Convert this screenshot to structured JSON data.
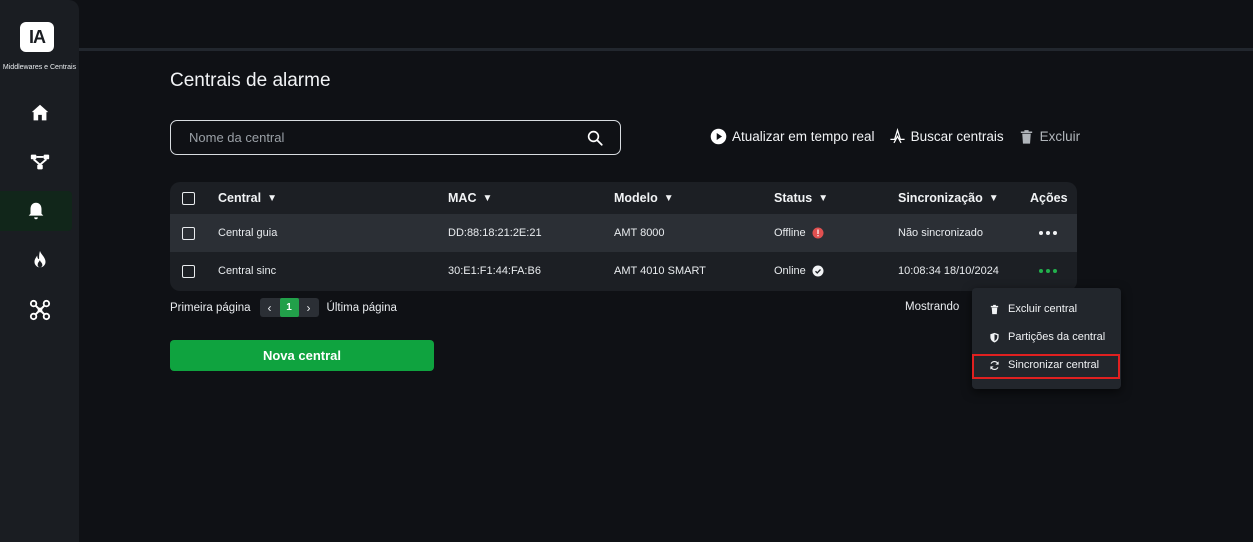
{
  "sidebar": {
    "logo_text": "IA",
    "brand_subtitle": "Middlewares e Centrais",
    "items": [
      {
        "icon": "home-icon"
      },
      {
        "icon": "network-icon"
      },
      {
        "icon": "bell-icon",
        "active": true
      },
      {
        "icon": "flame-icon"
      },
      {
        "icon": "drone-icon"
      }
    ]
  },
  "page": {
    "title": "Centrais de alarme"
  },
  "search": {
    "placeholder": "Nome da central",
    "value": ""
  },
  "toolbar": {
    "realtime_label": "Atualizar em tempo real",
    "search_label": "Buscar centrais",
    "delete_label": "Excluir"
  },
  "table": {
    "headers": {
      "central": "Central",
      "mac": "MAC",
      "modelo": "Modelo",
      "status": "Status",
      "sync": "Sincronização",
      "actions": "Ações"
    },
    "rows": [
      {
        "central": "Central guia",
        "mac": "DD:88:18:21:2E:21",
        "modelo": "AMT 8000",
        "status": "Offline",
        "sync": "Não sincronizado"
      },
      {
        "central": "Central sinc",
        "mac": "30:E1:F1:44:FA:B6",
        "modelo": "AMT 4010 SMART",
        "status": "Online",
        "sync": "10:08:34 18/10/2024"
      }
    ]
  },
  "pagination": {
    "first_label": "Primeira página",
    "current_page": "1",
    "last_label": "Última página",
    "showing_label": "Mostrando"
  },
  "new_button": {
    "label": "Nova central"
  },
  "context_menu": {
    "items": [
      {
        "label": "Excluir central",
        "icon": "trash-icon"
      },
      {
        "label": "Partições da central",
        "icon": "shield-icon"
      },
      {
        "label": "Sincronizar central",
        "icon": "sync-icon"
      }
    ]
  },
  "colors": {
    "accent_green": "#0fa33f",
    "offline_red": "#e05050",
    "highlight_red": "#e02020"
  }
}
